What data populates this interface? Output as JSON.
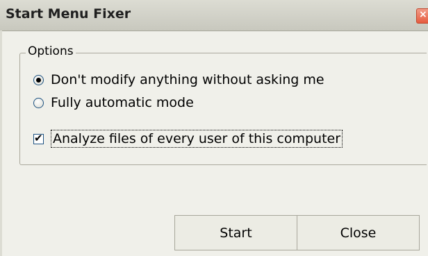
{
  "window": {
    "title": "Start Menu Fixer",
    "close_glyph": "×"
  },
  "options": {
    "legend": "Options",
    "radios": [
      {
        "label": "Don't modify anything without asking me",
        "selected": true
      },
      {
        "label": "Fully automatic mode",
        "selected": false
      }
    ],
    "checkbox": {
      "label": "Analyze files of every user of this computer",
      "checked": true,
      "check_glyph": "✔"
    }
  },
  "buttons": {
    "start_label": "Start",
    "close_label": "Close"
  },
  "colors": {
    "window_bg": "#f0f0ea",
    "titlebar": "#d4d4ca",
    "close_button": "#e65b3f"
  },
  "icons": [
    "close-icon",
    "radio-selected",
    "radio-unselected",
    "checkbox-checked"
  ]
}
